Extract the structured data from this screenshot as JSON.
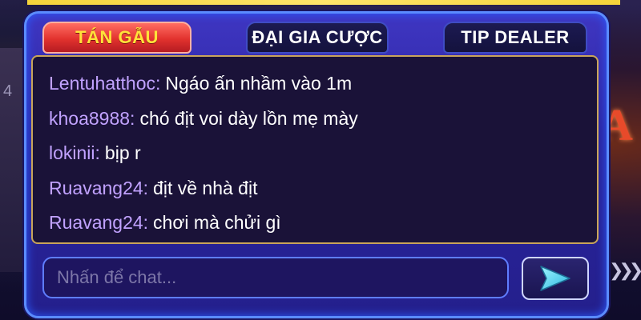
{
  "background": {
    "left_number": "4",
    "right_letter": "A"
  },
  "tabs": [
    {
      "label": "TÁN GẪU",
      "active": true
    },
    {
      "label": "ĐẠI GIA CƯỢC",
      "active": false
    },
    {
      "label": "TIP DEALER",
      "active": false
    }
  ],
  "messages": [
    {
      "user": "Lentuhatthoc",
      "text": "Ngáo ấn nhầm vào 1m"
    },
    {
      "user": "khoa8988",
      "text": "chó địt voi dày lồn mẹ mày"
    },
    {
      "user": "lokinii",
      "text": "bịp r"
    },
    {
      "user": "Ruavang24",
      "text": "địt về nhà địt"
    },
    {
      "user": "Ruavang24",
      "text": "chơi mà chửi gì"
    }
  ],
  "input": {
    "placeholder": "Nhấn để chat...",
    "value": ""
  },
  "send_button": {
    "icon": "send-arrow-icon"
  },
  "colors": {
    "active_tab_text": "#ffe23a",
    "username": "#c1a2ff",
    "message_text": "#ffffff",
    "panel_border": "#5b8cff",
    "chat_border": "#c9a55a",
    "send_icon": "#4fd8f0"
  }
}
